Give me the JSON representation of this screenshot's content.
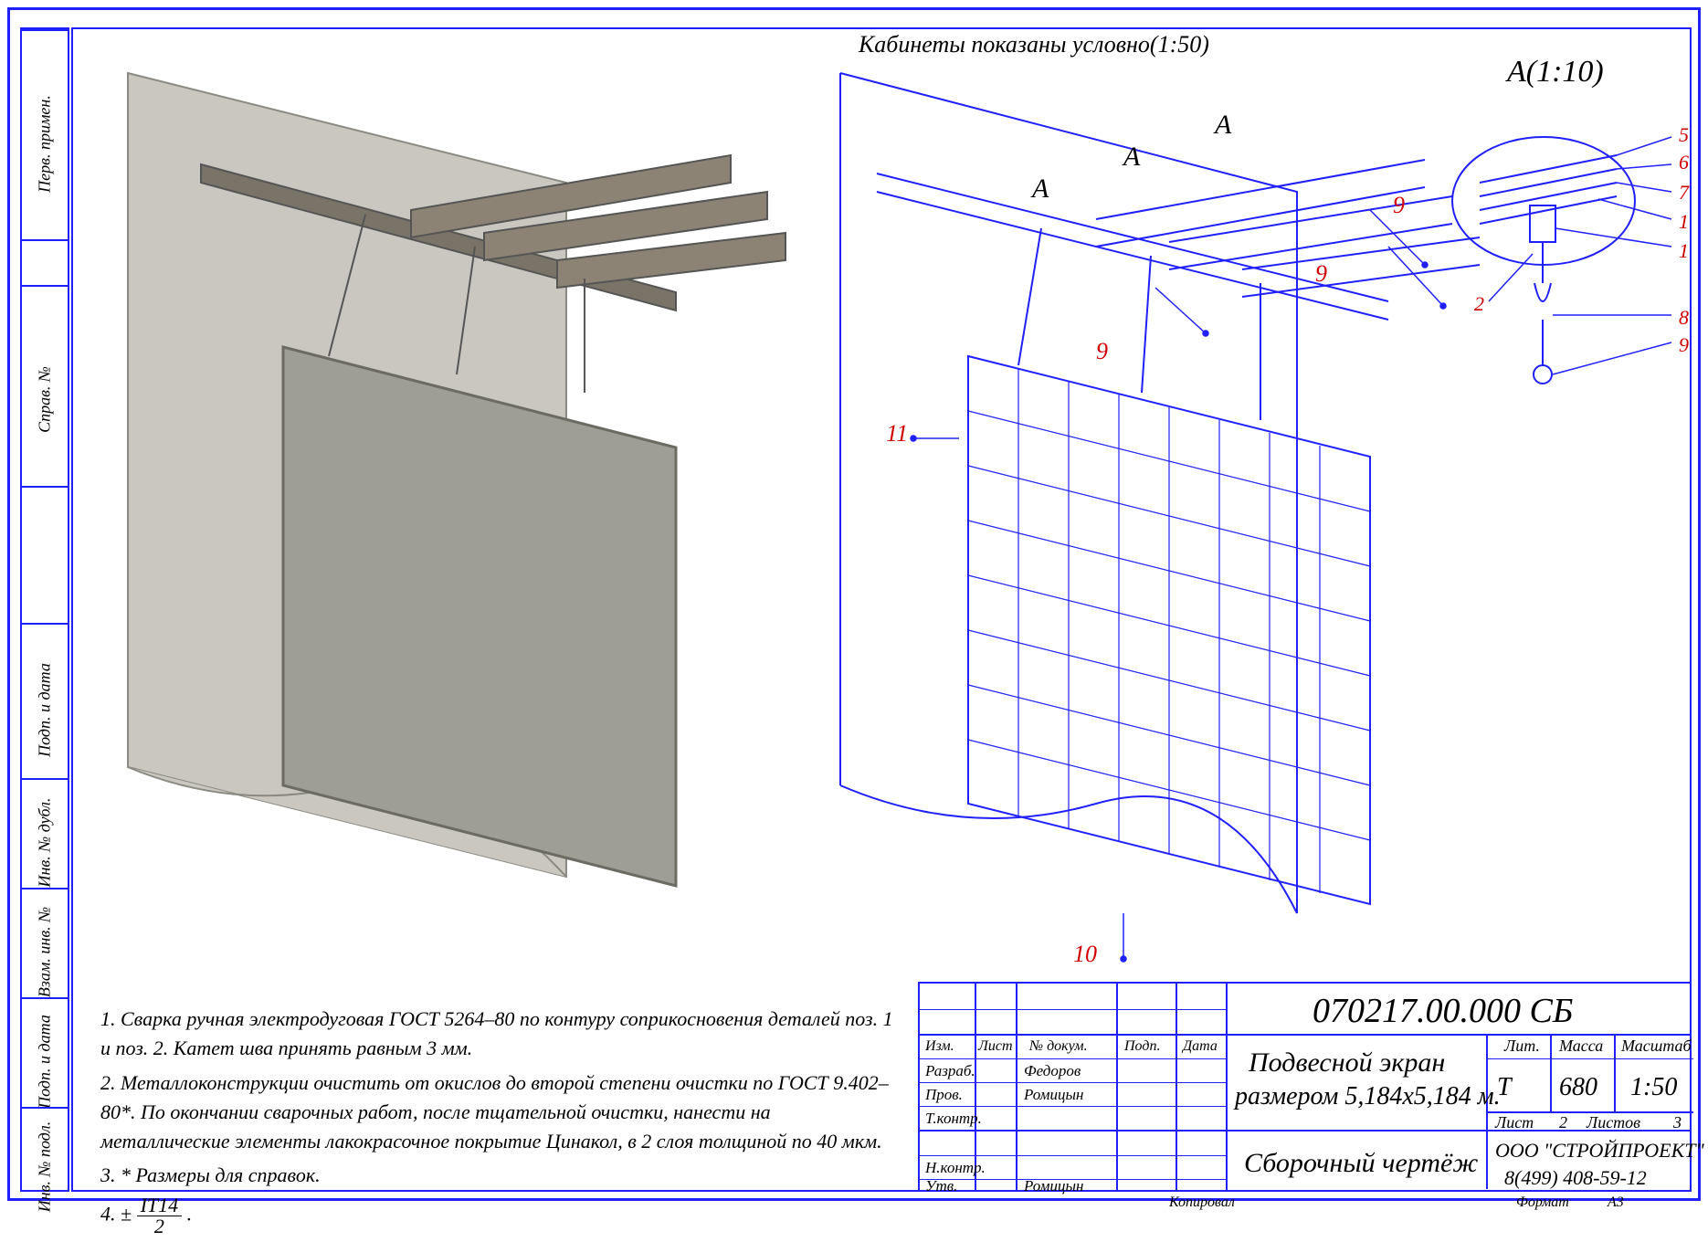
{
  "header_note": "Кабинеты показаны условно(1:50)",
  "detail_label": "А(1:10)",
  "view_labels": {
    "A1": "А",
    "A2": "А",
    "A3": "А"
  },
  "callouts": {
    "c9a": "9",
    "c9b": "9",
    "c9c": "9",
    "c11": "11",
    "c10": "10",
    "d5": "5",
    "d6": "6",
    "d7": "7",
    "d1a": "1",
    "d1b": "1",
    "d2": "2",
    "d8": "8",
    "d9": "9"
  },
  "notes": {
    "n1": "1. Сварка ручная электродуговая ГОСТ 5264–80 по контуру соприкосновения деталей поз. 1 и поз. 2. Катет шва принять равным 3 мм.",
    "n2": "2. Металлоконструкции очистить от окислов до второй степени очистки по ГОСТ 9.402–80*. По окончании сварочных работ, после тщательной очистки, нанести на металлические элементы лакокрасочное покрытие Цинакол, в 2 слоя толщиной по 40 мкм.",
    "n3": "3. * Размеры для справок.",
    "n4_prefix": "4. ±",
    "n4_num": "IT14",
    "n4_den": "2",
    "n4_suffix": "."
  },
  "sidebar": {
    "s1": "Перв. примен.",
    "s2": "Справ. №",
    "s3": "Подп. и дата",
    "s4": "Инв. № дубл.",
    "s5": "Взам. инв. №",
    "s6": "Подп. и дата",
    "s7": "Инв. № подл."
  },
  "titleblock": {
    "dwg_no": "070217.00.000 СБ",
    "title1": "Подвесной экран",
    "title2": "размером 5,184х5,184 м.",
    "doc_type": "Сборочный чертёж",
    "col_izm": "Изм.",
    "col_list": "Лист",
    "col_ndoc": "№ докум.",
    "col_podp": "Подп.",
    "col_data": "Дата",
    "row_razrab": "Разраб.",
    "row_prov": "Пров.",
    "row_tkontr": "Т.контр.",
    "row_nkontr": "Н.контр.",
    "row_utv": "Утв.",
    "name1": "Федоров",
    "name2": "Ромицын",
    "name3": "Ромицын",
    "lit_hdr": "Лит.",
    "mass_hdr": "Масса",
    "scale_hdr": "Масштаб",
    "lit_val": "Т",
    "mass_val": "680",
    "scale_val": "1:50",
    "sheet_lbl": "Лист",
    "sheet_val": "2",
    "sheets_lbl": "Листов",
    "sheets_val": "3",
    "company1": "ООО \"СТРОЙПРОЕКТ\"",
    "company2": "8(499) 408-59-12",
    "kopiroval": "Копировал",
    "format_lbl": "Формат",
    "format_val": "А3"
  }
}
